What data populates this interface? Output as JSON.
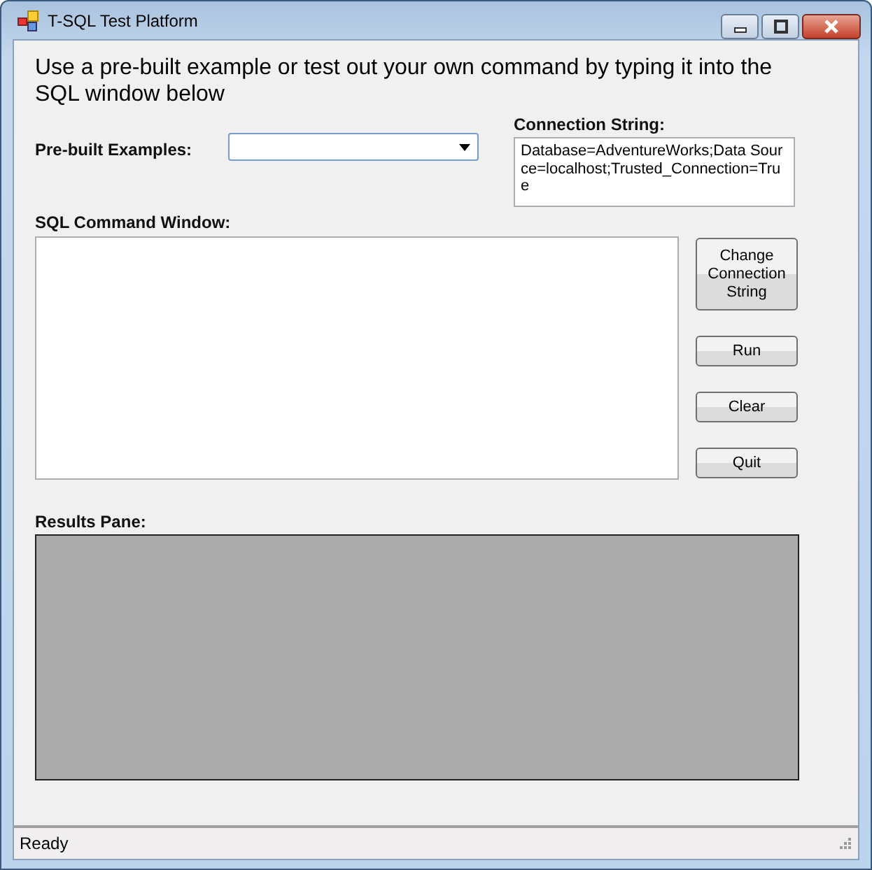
{
  "window": {
    "title": "T-SQL Test Platform"
  },
  "instructions": "Use a pre-built example or test out your own command by typing it into the SQL window below",
  "examples": {
    "label": "Pre-built Examples:"
  },
  "connection": {
    "label": "Connection String:",
    "value": "Database=AdventureWorks;Data Source=localhost;Trusted_Connection=True"
  },
  "sql": {
    "label": "SQL Command Window:"
  },
  "buttons": [
    "Change Connection String",
    "Run",
    "Clear",
    "Quit"
  ],
  "results": {
    "label": "Results Pane:"
  },
  "status_bar": "Ready"
}
